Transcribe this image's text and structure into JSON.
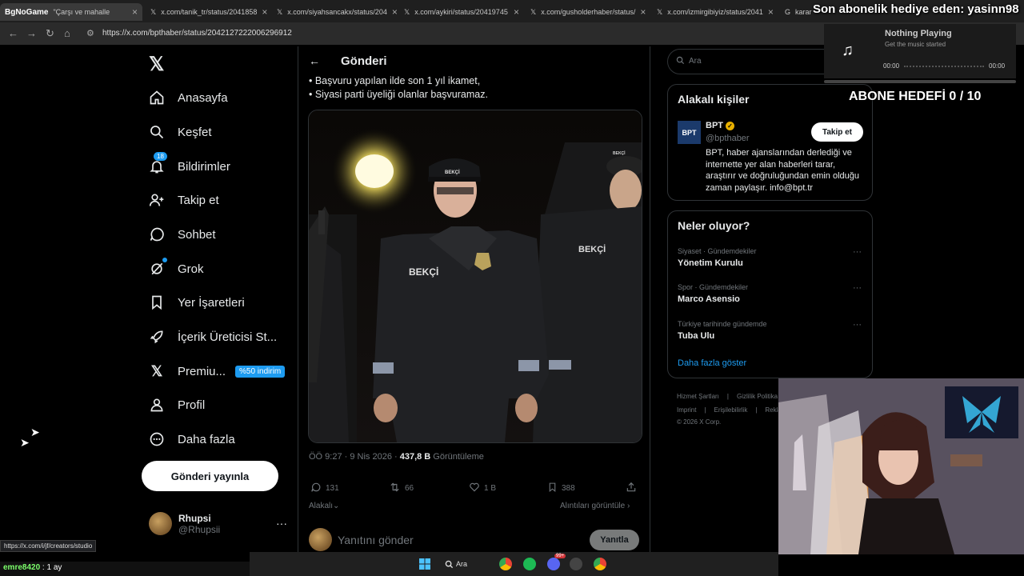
{
  "browser": {
    "tabs": [
      {
        "label": "\"Çarşı ve mahalle",
        "overlay": "BgNoGame"
      },
      {
        "label": "x.com/tanik_tr/status/2041858"
      },
      {
        "label": "x.com/siyahsancakx/status/204"
      },
      {
        "label": "x.com/aykiri/status/20419745"
      },
      {
        "label": "x.com/gusholderhaber/status/"
      },
      {
        "label": "x.com/izmirgibiyiz/status/2041"
      },
      {
        "label": "karar"
      }
    ],
    "url": "https://x.com/bpthaber/status/2042127222006296912"
  },
  "sidebar": {
    "logo": "𝕏",
    "items": [
      {
        "label": "Anasayfa",
        "icon": "home-icon"
      },
      {
        "label": "Keşfet",
        "icon": "search-icon"
      },
      {
        "label": "Bildirimler",
        "icon": "bell-icon",
        "badge": "18"
      },
      {
        "label": "Takip et",
        "icon": "add-person-icon"
      },
      {
        "label": "Sohbet",
        "icon": "chat-icon"
      },
      {
        "label": "Grok",
        "icon": "grok-icon"
      },
      {
        "label": "Yer İşaretleri",
        "icon": "bookmark-icon"
      },
      {
        "label": "İçerik Üreticisi St...",
        "icon": "rocket-icon"
      },
      {
        "label": "Premiu...",
        "icon": "x-premium-icon",
        "tag": "%50 indirim"
      },
      {
        "label": "Profil",
        "icon": "profile-icon"
      },
      {
        "label": "Daha fazla",
        "icon": "more-circle-icon"
      }
    ],
    "post_button": "Gönderi yayınla",
    "account": {
      "name": "Rhupsi",
      "handle": "@Rhupsii",
      "more": "···"
    }
  },
  "post": {
    "header": "Gönderi",
    "lines": [
      "• Başvuru yapılan ilde son 1 yıl ikamet,",
      "• Siyasi parti üyeliği olanlar başvuramaz."
    ],
    "image_texts": {
      "cap1": "BEKÇİ",
      "left": "BEKÇİ",
      "right": "BEKÇİ",
      "cap2": "BEKÇİ"
    },
    "time": "ÖÖ 9:27 · 9 Nis 2026 · ",
    "views": "437,8 B",
    "views_label": " Görüntüleme",
    "actions": {
      "replies": "131",
      "reposts": "66",
      "likes": "1 B",
      "bookmarks": "388"
    },
    "relevant": "Alakalı",
    "quotes": "Alıntıları görüntüle",
    "reply_placeholder": "Yanıtını gönder",
    "reply_button": "Yanıtla"
  },
  "right": {
    "search_placeholder": "Ara",
    "related_title": "Alakalı kişiler",
    "bpt": {
      "logo": "BPT",
      "name": "BPT",
      "handle": "@bpthaber",
      "follow": "Takip et",
      "bio": "BPT, haber ajanslarından derlediği ve internette yer alan haberleri tarar, araştırır ve doğruluğundan emin olduğu zaman paylaşır. info@bpt.tr"
    },
    "trends_title": "Neler oluyor?",
    "trends": [
      {
        "category": "Siyaset · Gündemdekiler",
        "name": "Yönetim Kurulu"
      },
      {
        "category": "Spor · Gündemdekiler",
        "name": "Marco Asensio"
      },
      {
        "category": "Türkiye tarihinde gündemde",
        "name": "Tuba Ulu"
      }
    ],
    "show_more": "Daha fazla göster",
    "footer1": [
      "Hizmet Şartları",
      "|",
      "Gizlilik Politika"
    ],
    "footer2": [
      "Imprint",
      "|",
      "Erişilebilirlik",
      "|",
      "Rekla"
    ],
    "footer3": "© 2026 X Corp."
  },
  "overlay": {
    "subscriber": "Son abonelik hediye eden: yasinn98",
    "music_title": "Nothing Playing",
    "music_sub": "Get the music started",
    "time_start": "00:00",
    "time_end": "00:00",
    "goal": "ABONE HEDEFİ 0 / 10"
  },
  "status_url": "https://x.com/i/jf/creators/studio",
  "chat": {
    "user": "emre8420",
    "message": " : 1 ay"
  },
  "taskbar": {
    "search": "Ara",
    "notif_badge": "99+"
  }
}
